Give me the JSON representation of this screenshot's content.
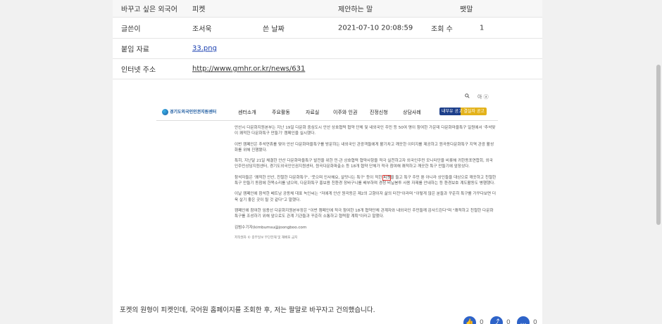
{
  "table": {
    "rows": [
      {
        "label1": "바꾸고 싶은 외국어",
        "value1": "피켓",
        "label2": "제안하는 말",
        "value2": "팻말"
      },
      {
        "label1": "글쓴이",
        "value1": "조서욱",
        "label2": "쓴 날짜",
        "value2": "2021-07-10 20:08:59",
        "label3": "조회 수",
        "value3": "1"
      },
      {
        "label1": "붙임 자료",
        "value1": "33.png"
      },
      {
        "label1": "인터넷 주소",
        "value1": "http://www.gmhr.or.kr/news/631"
      }
    ]
  },
  "screenshot": {
    "logo_text": "경기도외국인인권지원센터",
    "nav": [
      "센터소개",
      "주요활동",
      "자료실",
      "이주와 인권",
      "진정신청",
      "상담사례"
    ],
    "badge": "내부유 공고  결실자 공고",
    "toggles": "아 ⓐ",
    "paragraphs": [
      "안산시 다문화지원본부는 지난 19일 다문화 중심도시 안산 상호협력 협약 단체 및 내외국인 주민 등 50여 명이 참여한 가운데 다문화마을특구 일원에서 '추석맞이 쾌적한 다문화특구 만들기' 캠페인을 실시했다.",
      "이번 캠페인은 추석연휴를 맞아 안산 다문화마을특구를 방문하는 내외국인 관광객들에게 활기차고 깨끗한 이미지를 제공하고 원곡동다문화특구 지역 관광 활성화를 위해 진행됐다.",
      "특히, 지난달 21일 체결한 안산 다문화마을특구 발전을 위한 민·관 상호협력 협약사항을 적극 실천하고자 외국인주민 모니터단을 비롯해 귀한동포연합회, 외국인주민상담지원센터, 경기도외국인인권지원센터, 원곡다문화파출소 등 18개 협약 단체가 적극 참여해 쾌적하고 깨끗한 특구 만들기에 앞장섰다.",
      "참석자들은 '쾌적한 안산, 친절한 다문화특구', '웃으며 인사해요, 살맛나는 특구' 등이 적힌",
      "피켓",
      "을 들고 특구 주민 뿐 아니라 상인들을 대상으로 깨끗하고 친절한 특구 만들기 동참에 한목소리를 냈으며, 다문화특구 홍보용 친환경 장바구니를 배부하며 경청 비닐봉투 사용 자제를 안내하는 등 환경보호 계도활동도 병행했다.",
      "이날 캠페인에 참석한 베트남 공동체 대표 녹인씨는 \"저에게 안산 원곡동은 제2의 고향이자 삶의 터전\"이라며 \"이렇게 많은 분들과 꾸준히 특구를 가꾸다보면 더욱 살기 좋은 곳이 될 것 같다\"고 말했다.",
      "캠페인에 참여한 임종선 다문화지원본부장은 \"이번 캠페인에 적극 참여한 18개 협약단체 관계자와 내외국인 주민들께 감사드린다\"며 \"쾌적하고 친절한 다문화특구를 조성하기 위해 앞으로도 관계 기관들과 꾸준히 소통하고 협력할 계획\"이라고 말했다.",
      "김범수기자(kimbumsu@joongboo.com",
      "저작권자 © 중부일보 무단전재 및 재배포 금지"
    ]
  },
  "comment": "포켓의 원형이 피켓인데, 국어원 홈페이지를 조회한 후, 저는 팔말로 바꾸자고 건의했습니다.",
  "actions": [
    {
      "icon": "thumbs-up-icon",
      "count": "0"
    },
    {
      "icon": "share-icon",
      "count": "0"
    },
    {
      "icon": "comment-icon",
      "count": "0"
    }
  ],
  "colors": {
    "link": "#1a3fb0",
    "accent": "#2e63c8",
    "highlight": "#e53935"
  }
}
